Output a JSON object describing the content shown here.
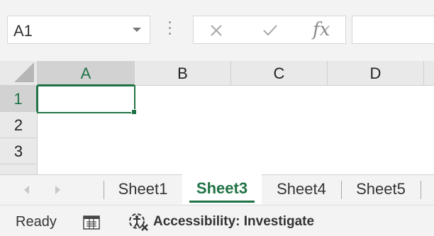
{
  "formula_bar": {
    "name_box_value": "A1",
    "fx_label": "fx",
    "formula_value": ""
  },
  "grid": {
    "columns": [
      "A",
      "B",
      "C",
      "D"
    ],
    "rows": [
      "1",
      "2",
      "3"
    ],
    "active_cell": "A1"
  },
  "sheet_tabs": {
    "tabs": [
      {
        "label": "Sheet1",
        "active": false
      },
      {
        "label": "Sheet3",
        "active": true
      },
      {
        "label": "Sheet4",
        "active": false
      },
      {
        "label": "Sheet5",
        "active": false
      }
    ]
  },
  "status_bar": {
    "status": "Ready",
    "accessibility": "Accessibility: Investigate"
  },
  "colors": {
    "accent": "#217346",
    "chrome_bg": "#f3f3f3",
    "header_bg": "#e9e9e9"
  }
}
